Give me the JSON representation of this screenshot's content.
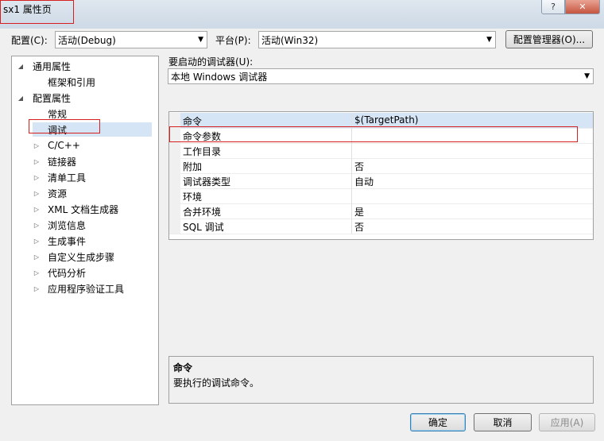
{
  "window": {
    "title": "sx1 属性页",
    "help_label": "?",
    "close_label": "✕"
  },
  "config": {
    "label": "配置(C):",
    "value": "活动(Debug)"
  },
  "platform": {
    "label": "平台(P):",
    "value": "活动(Win32)"
  },
  "config_manager_label": "配置管理器(O)...",
  "debugger": {
    "label": "要启动的调试器(U):",
    "value": "本地 Windows 调试器"
  },
  "tree": [
    {
      "label": "通用属性",
      "expander": "◢"
    },
    {
      "label": "框架和引用",
      "expander": ""
    },
    {
      "label": "配置属性",
      "expander": "◢"
    },
    {
      "label": "常规",
      "expander": ""
    },
    {
      "label": "调试",
      "expander": ""
    },
    {
      "label": "C/C++",
      "expander": "▷"
    },
    {
      "label": "链接器",
      "expander": "▷"
    },
    {
      "label": "清单工具",
      "expander": "▷"
    },
    {
      "label": "资源",
      "expander": "▷"
    },
    {
      "label": "XML 文档生成器",
      "expander": "▷"
    },
    {
      "label": "浏览信息",
      "expander": "▷"
    },
    {
      "label": "生成事件",
      "expander": "▷"
    },
    {
      "label": "自定义生成步骤",
      "expander": "▷"
    },
    {
      "label": "代码分析",
      "expander": "▷"
    },
    {
      "label": "应用程序验证工具",
      "expander": "▷"
    }
  ],
  "properties": [
    {
      "name": "命令",
      "value": "$(TargetPath)"
    },
    {
      "name": "命令参数",
      "value": ""
    },
    {
      "name": "工作目录",
      "value": ""
    },
    {
      "name": "附加",
      "value": "否"
    },
    {
      "name": "调试器类型",
      "value": "自动"
    },
    {
      "name": "环境",
      "value": ""
    },
    {
      "name": "合并环境",
      "value": "是"
    },
    {
      "name": "SQL 调试",
      "value": "否"
    }
  ],
  "description": {
    "title": "命令",
    "text": "要执行的调试命令。"
  },
  "buttons": {
    "ok": "确定",
    "cancel": "取消",
    "apply": "应用(A)"
  },
  "colors": {
    "annotation": "#d62020",
    "selection": "#d6e5f5"
  }
}
